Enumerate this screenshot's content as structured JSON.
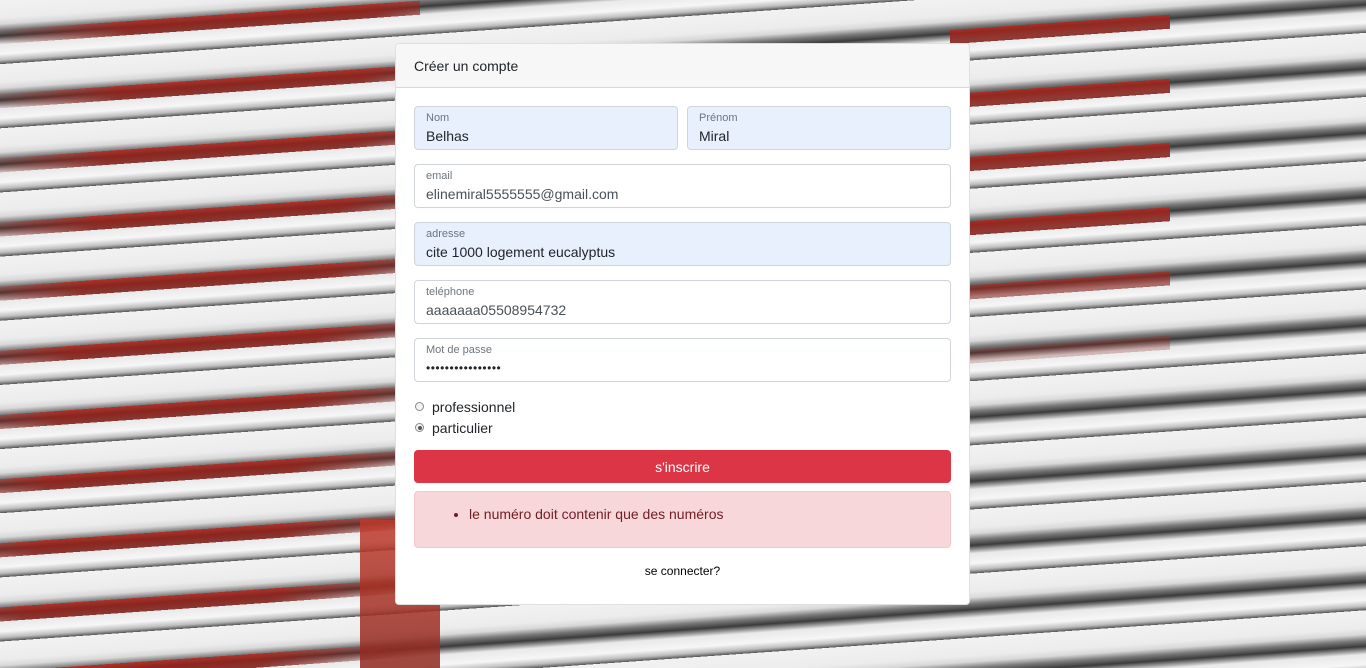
{
  "card": {
    "title": "Créer un compte"
  },
  "form": {
    "nom": {
      "label": "Nom",
      "value": "Belhas"
    },
    "prenom": {
      "label": "Prénom",
      "value": "Miral"
    },
    "email": {
      "label": "email",
      "value": "elinemiral5555555@gmail.com"
    },
    "adresse": {
      "label": "adresse",
      "value": "cite 1000 logement eucalyptus"
    },
    "telephone": {
      "label": "teléphone",
      "value": "aaaaaaa05508954732"
    },
    "password": {
      "label": "Mot de passe",
      "value": "••••••••••••••••"
    },
    "account_type": {
      "options": [
        {
          "label": "professionnel",
          "checked": false
        },
        {
          "label": "particulier",
          "checked": true
        }
      ]
    },
    "submit_label": "s'inscrire"
  },
  "errors": [
    "le numéro doit contenir que des numéros"
  ],
  "footer": {
    "login_link": "se connecter?"
  },
  "colors": {
    "submit_button": "#dc3545",
    "error_background": "#f8d7da",
    "error_text": "#721c24",
    "autofill_background": "#e8f0fe"
  }
}
